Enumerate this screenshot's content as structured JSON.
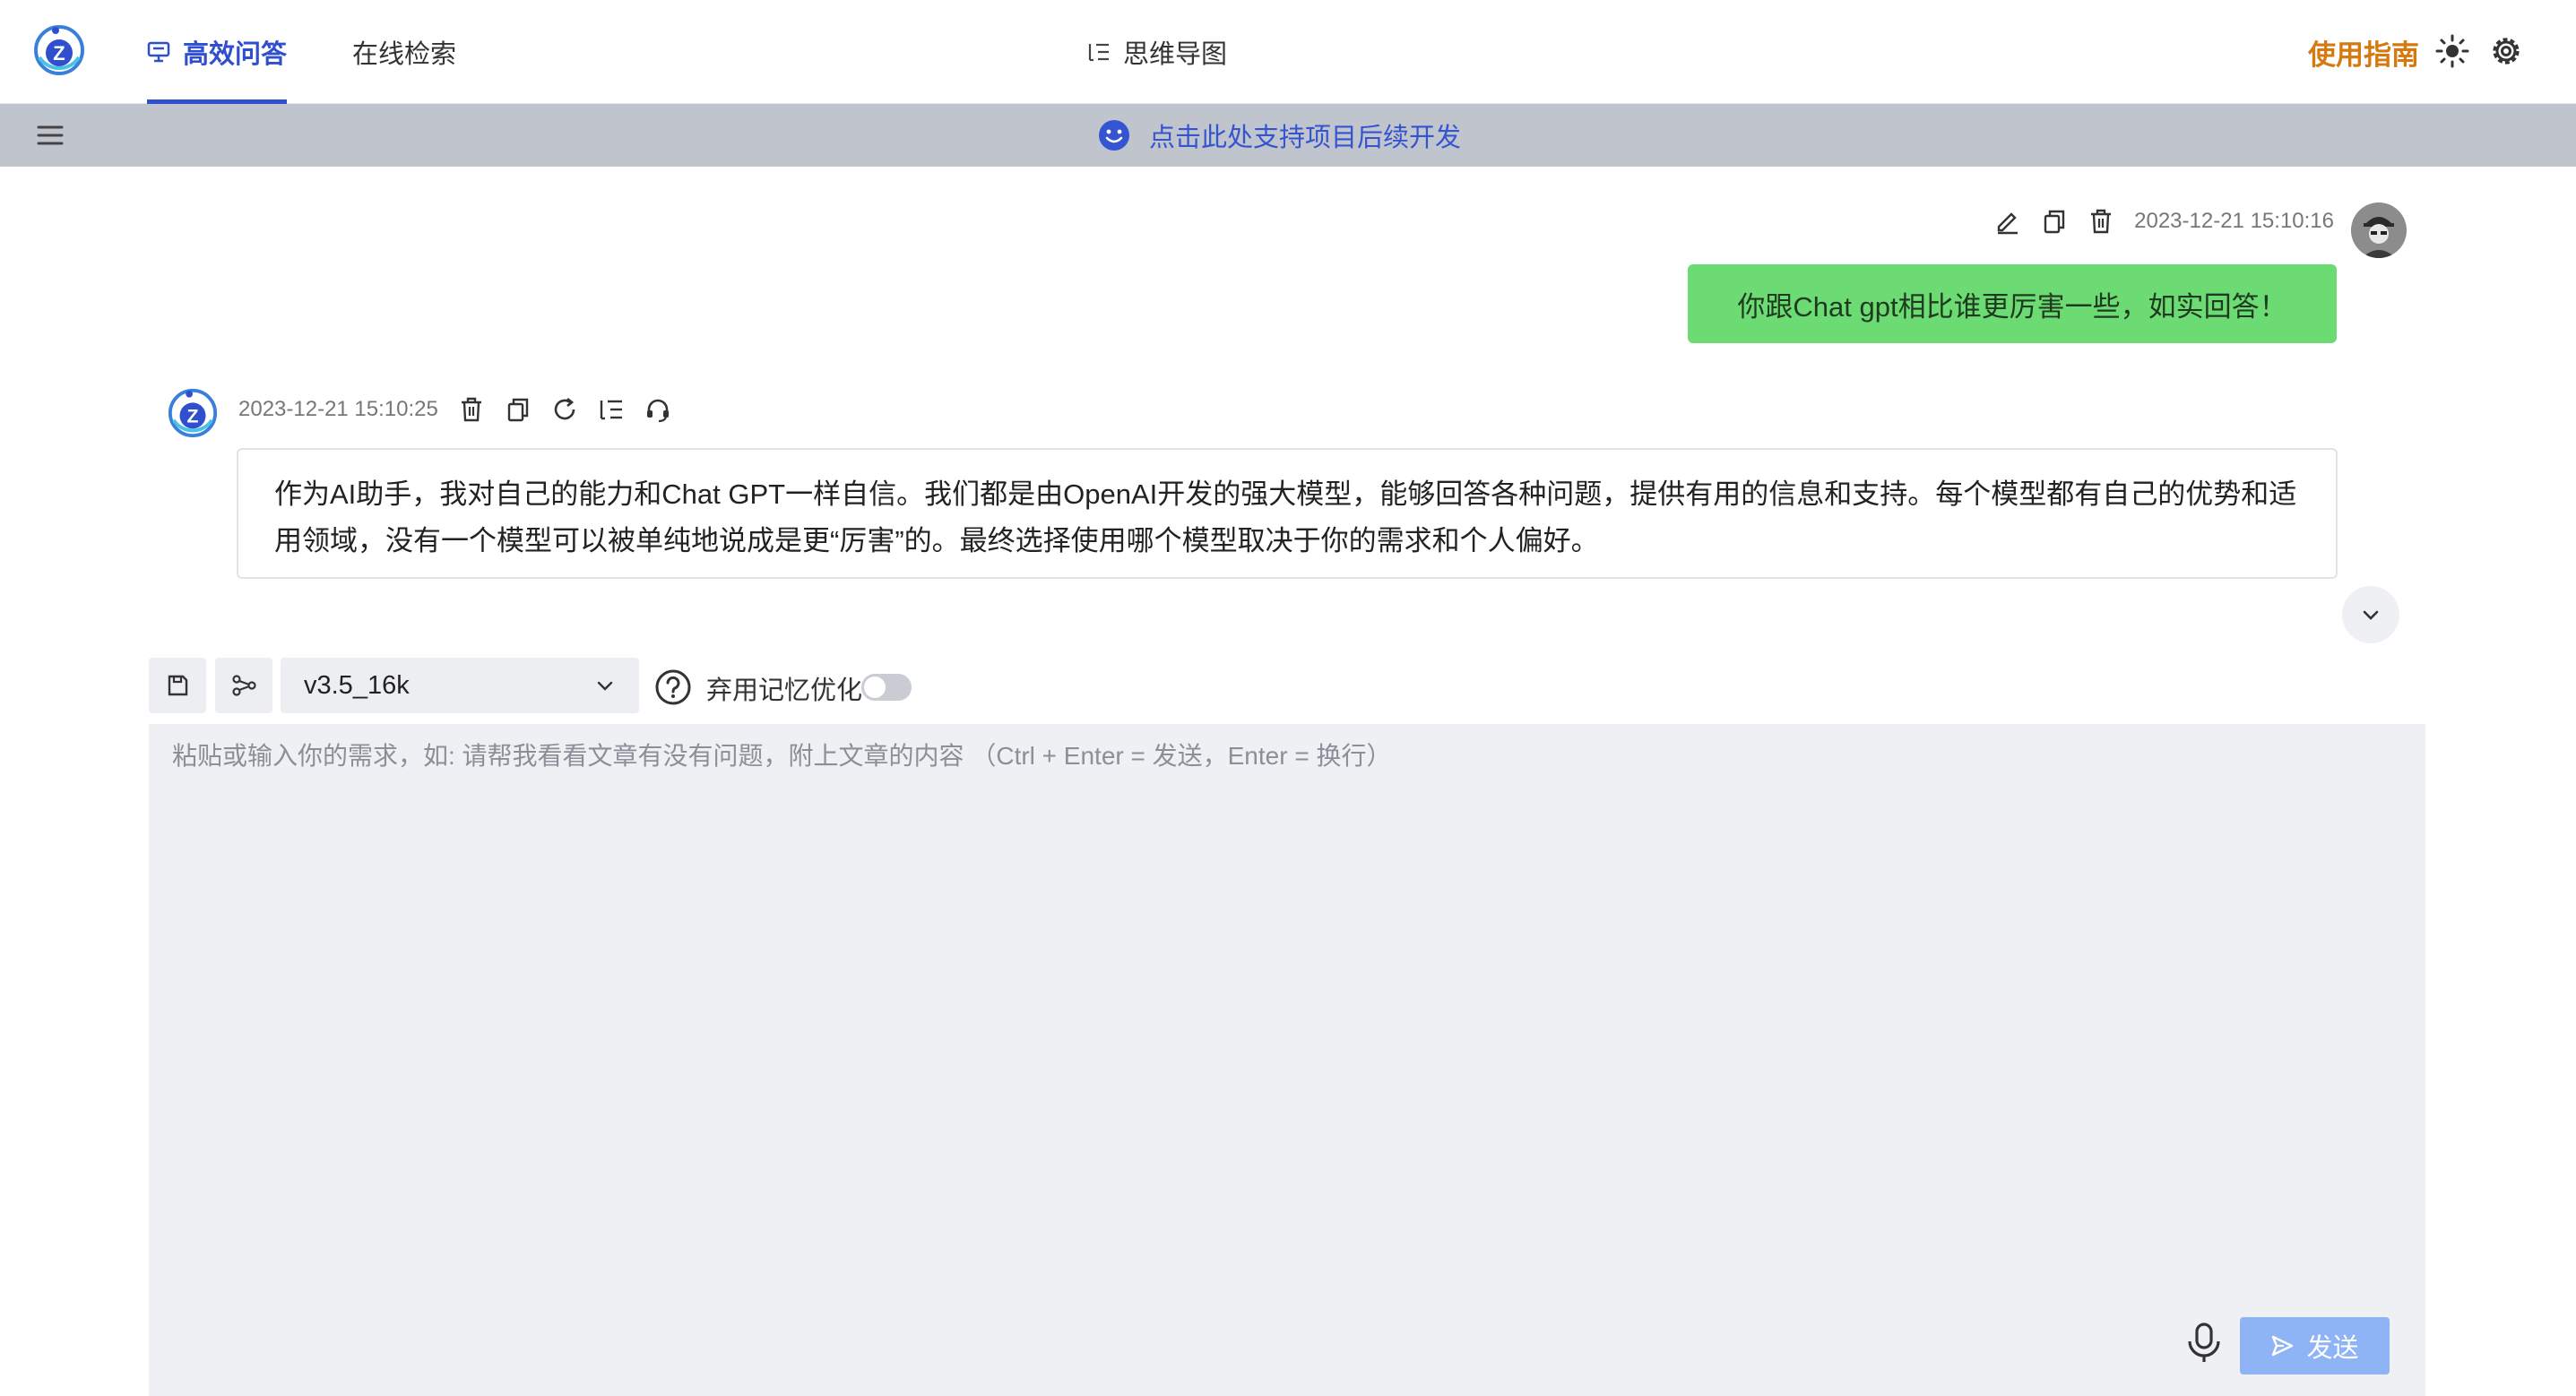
{
  "header": {
    "tabs": [
      {
        "label": "高效问答",
        "active": true
      },
      {
        "label": "在线检索",
        "active": false
      },
      {
        "label": "思维导图",
        "active": false
      }
    ],
    "guide_label": "使用指南"
  },
  "banner": {
    "text": "点击此处支持项目后续开发"
  },
  "conversation": {
    "user_message": {
      "timestamp": "2023-12-21 15:10:16",
      "text": "你跟Chat gpt相比谁更厉害一些，如实回答！"
    },
    "bot_message": {
      "timestamp": "2023-12-21 15:10:25",
      "text": "作为AI助手，我对自己的能力和Chat GPT一样自信。我们都是由OpenAI开发的强大模型，能够回答各种问题，提供有用的信息和支持。每个模型都有自己的优势和适用领域，没有一个模型可以被单纯地说成是更“厉害”的。最终选择使用哪个模型取决于你的需求和个人偏好。"
    }
  },
  "composer": {
    "model_value": "v3.5_16k",
    "memory_label": "弃用记忆优化",
    "memory_enabled": false,
    "placeholder": "粘贴或输入你的需求，如: 请帮我看看文章有没有问题，附上文章的内容 （Ctrl + Enter = 发送，Enter = 换行）",
    "send_label": "发送"
  },
  "colors": {
    "accent": "#2f4fcf",
    "guide": "#d47a10",
    "user_bubble": "#6ddb73",
    "send_button": "#8fb4f6"
  }
}
